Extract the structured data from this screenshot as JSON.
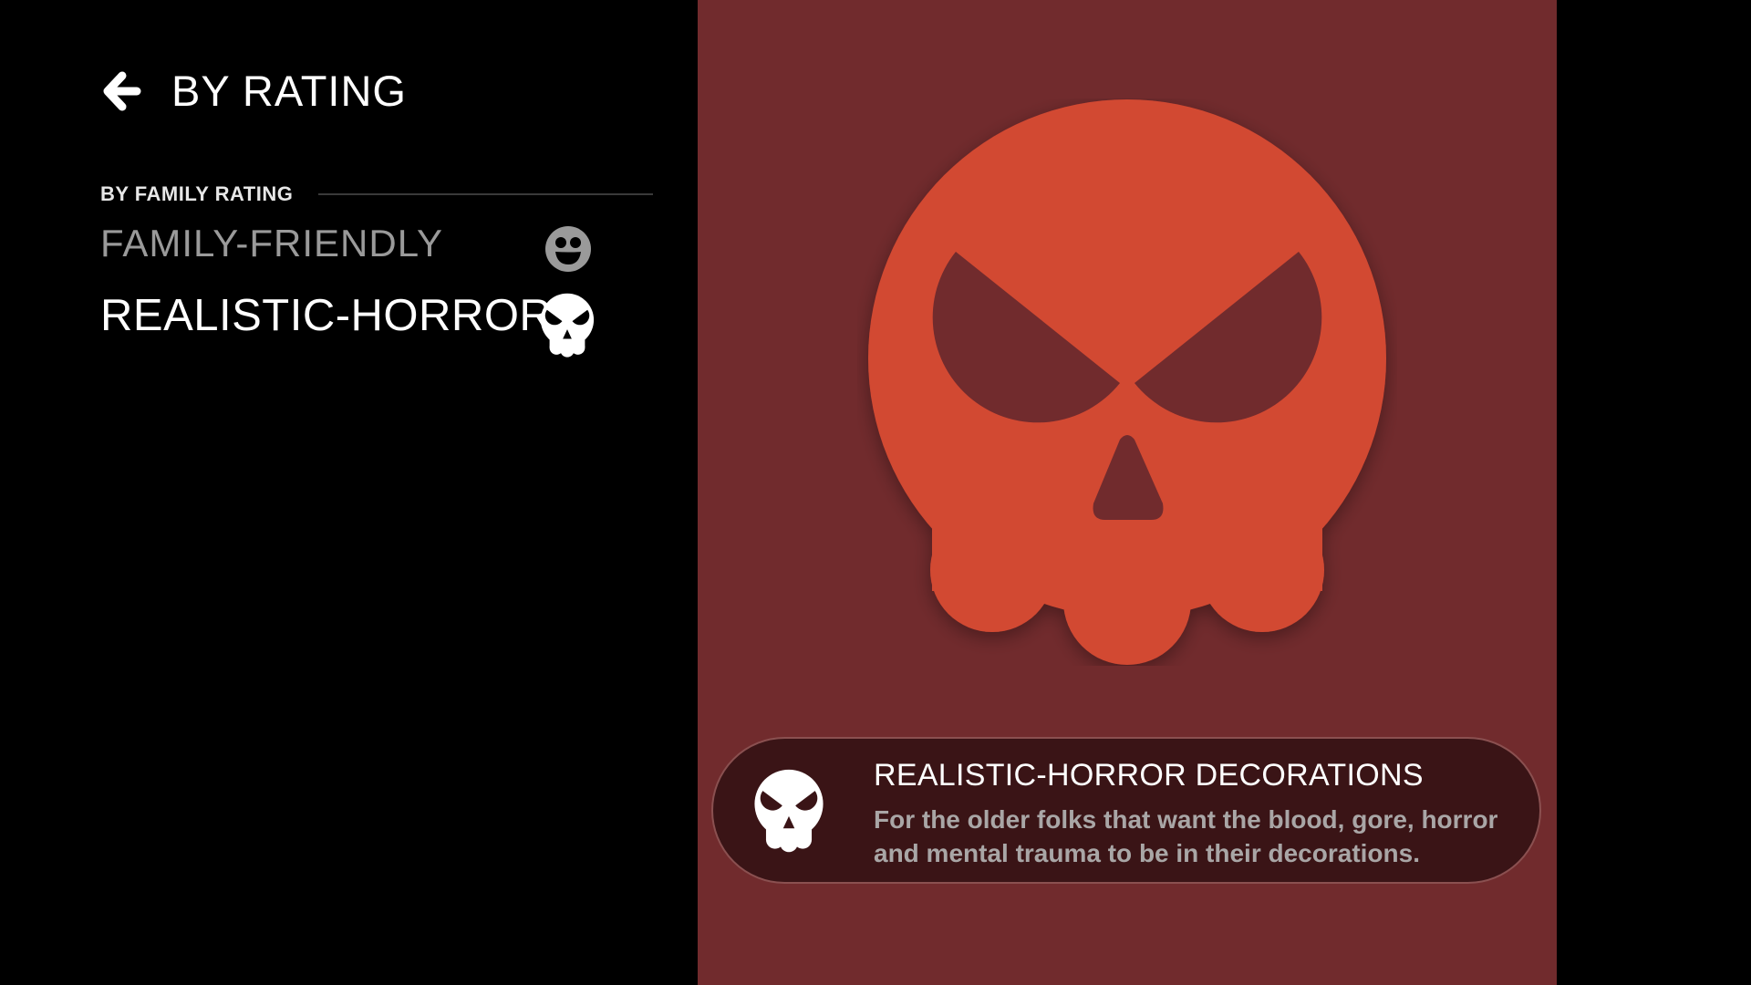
{
  "header": {
    "back_icon": "arrow-left-icon",
    "title": "BY RATING"
  },
  "section": {
    "label": "BY FAMILY RATING"
  },
  "menu": {
    "items": [
      {
        "label": "FAMILY-FRIENDLY",
        "icon": "smiley-face-icon",
        "selected": false
      },
      {
        "label": "REALISTIC-HORROR",
        "icon": "skull-icon",
        "selected": true
      }
    ]
  },
  "preview": {
    "background_color": "#712b2d",
    "hero_icon": "skull-icon",
    "hero_color": "#d24a33",
    "card": {
      "icon": "skull-icon",
      "title": "REALISTIC-HORROR DECORATIONS",
      "description": "For the older folks that want the blood, gore, horror and mental trauma to be in their decorations."
    }
  },
  "colors": {
    "page_background": "#000000",
    "selected_text": "#ffffff",
    "unselected_text": "#9a9a9a",
    "card_background": "#3a1416"
  }
}
